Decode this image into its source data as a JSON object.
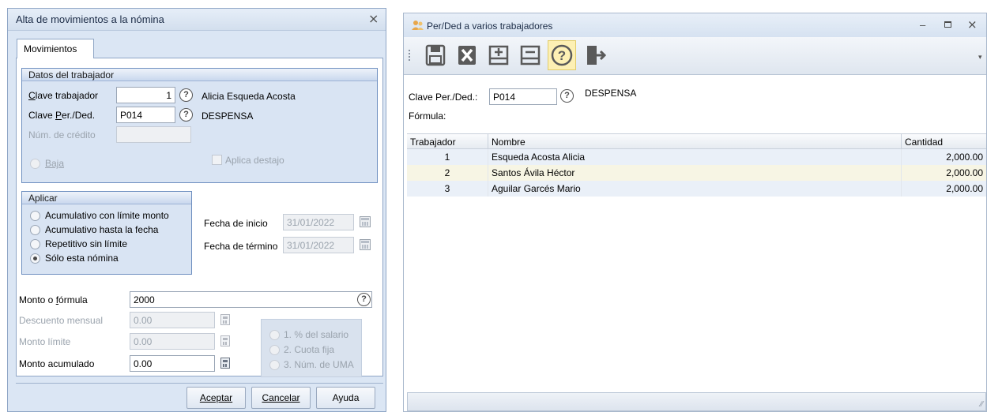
{
  "left_dialog": {
    "title": "Alta de movimientos a la nómina",
    "tab_label": "Movimientos",
    "datos": {
      "header": "Datos del trabajador",
      "clave_trab_label": "Clave trabajador",
      "clave_trab_value": "1",
      "trabajador_nombre": "Alicia Esqueda Acosta",
      "clave_perded_label": "Clave Per./Ded.",
      "clave_perded_value": "P014",
      "perded_nombre": "DESPENSA",
      "num_credito_label": "Núm. de crédito",
      "num_credito_value": "",
      "baja_label": "Baja",
      "aplica_destajo_label": "Aplica destajo"
    },
    "aplicar": {
      "header": "Aplicar",
      "options": [
        {
          "label": "Acumulativo con límite monto",
          "checked": false
        },
        {
          "label": "Acumulativo hasta la fecha",
          "checked": false
        },
        {
          "label": "Repetitivo sin límite",
          "checked": false
        },
        {
          "label": "Sólo esta nómina",
          "checked": true
        }
      ]
    },
    "fechas": {
      "inicio_label": "Fecha de inicio",
      "inicio_value": "31/01/2022",
      "termino_label": "Fecha de término",
      "termino_value": "31/01/2022"
    },
    "montos": {
      "monto_formula_label": "Monto o fórmula",
      "monto_formula_value": "2000",
      "descuento_mensual_label": "Descuento mensual",
      "descuento_mensual_value": "0.00",
      "monto_limite_label": "Monto límite",
      "monto_limite_value": "0.00",
      "monto_acumulado_label": "Monto acumulado",
      "monto_acumulado_value": "0.00"
    },
    "tipo_options": [
      "1. % del salario",
      "2. Cuota fija",
      "3. Núm. de UMA"
    ],
    "buttons": {
      "aceptar": "Aceptar",
      "cancelar": "Cancelar",
      "ayuda": "Ayuda"
    }
  },
  "right_window": {
    "title": "Per/Ded a varios trabajadores",
    "toolbar_icons": [
      "save-icon",
      "delete-icon",
      "add-row-icon",
      "remove-row-icon",
      "help-icon",
      "exit-icon"
    ],
    "clave_perded_label": "Clave Per./Ded.:",
    "clave_perded_value": "P014",
    "perded_nombre": "DESPENSA",
    "formula_label": "Fórmula:",
    "grid": {
      "columns": [
        "Trabajador",
        "Nombre",
        "Cantidad"
      ],
      "rows": [
        {
          "trabajador": "1",
          "nombre": "Esqueda Acosta Alicia",
          "cantidad": "2,000.00"
        },
        {
          "trabajador": "2",
          "nombre": "Santos Ávila Héctor",
          "cantidad": "2,000.00"
        },
        {
          "trabajador": "3",
          "nombre": "Aguilar Garcés Mario",
          "cantidad": "2,000.00"
        }
      ]
    }
  },
  "colors": {
    "dialog_bg": "#dbe6f4",
    "group_border": "#6e8fc0",
    "active_tool_bg": "#fdf0b4"
  }
}
